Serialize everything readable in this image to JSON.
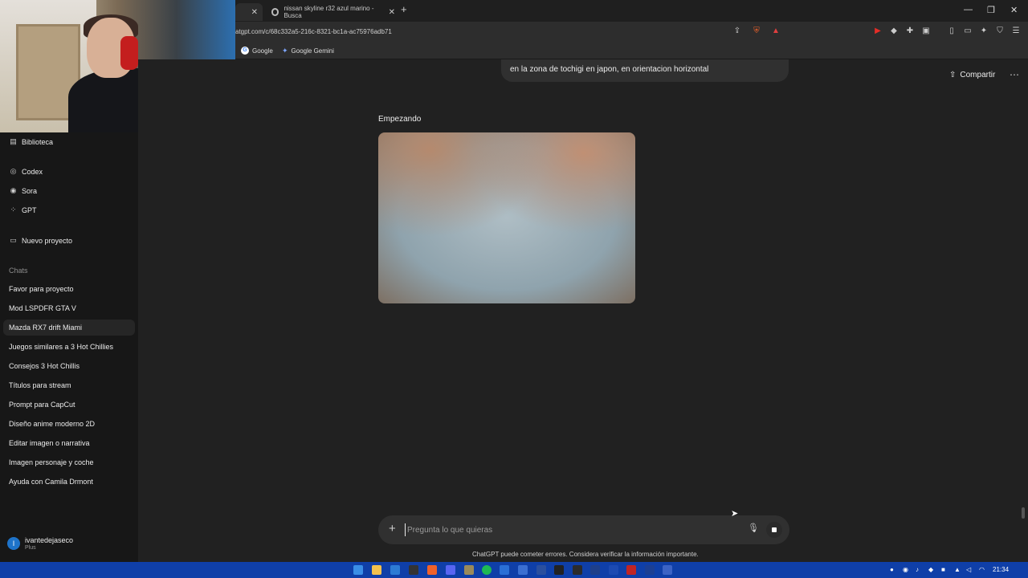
{
  "browser": {
    "tabs": [
      {
        "label": ""
      },
      {
        "label": "nissan skyline r32 azul marino - Busca"
      }
    ],
    "url": "atgpt.com/c/68c332a5-216c-8321-bc1a-ac75976adb71",
    "bookmarks": [
      {
        "label": "Google"
      },
      {
        "label": "Google Gemini"
      }
    ]
  },
  "sidebar": {
    "top_items": [
      {
        "label": "Biblioteca",
        "icon": "library-icon"
      },
      {
        "label": "Codex",
        "icon": "codex-icon"
      },
      {
        "label": "Sora",
        "icon": "sora-icon"
      },
      {
        "label": "GPT",
        "icon": "gpt-grid-icon"
      },
      {
        "label": "Nuevo proyecto",
        "icon": "folder-icon"
      }
    ],
    "chats_heading": "Chats",
    "chats": [
      {
        "label": "Favor para proyecto"
      },
      {
        "label": "Mod LSPDFR GTA V"
      },
      {
        "label": "Mazda RX7 drift Miami"
      },
      {
        "label": "Juegos similares a 3 Hot Chillies"
      },
      {
        "label": "Consejos 3 Hot Chillis"
      },
      {
        "label": "Títulos para stream"
      },
      {
        "label": "Prompt para CapCut"
      },
      {
        "label": "Diseño anime moderno 2D"
      },
      {
        "label": "Editar imagen o narrativa"
      },
      {
        "label": "Imagen personaje y coche"
      },
      {
        "label": "Ayuda con Camila Drmont"
      }
    ],
    "active_chat_index": 2,
    "user": {
      "initial": "I",
      "name": "ivantedejaseco",
      "plan": "Plus"
    }
  },
  "main": {
    "user_message_tail": "en la zona de tochigi en japon, en orientacion horizontal",
    "share_label": "Compartir",
    "status_label": "Empezando",
    "composer": {
      "placeholder": "Pregunta lo que quieras"
    },
    "disclaimer": "ChatGPT puede cometer errores. Considera verificar la información importante."
  },
  "taskbar": {
    "time": "21:34"
  },
  "colors": {
    "background": "#212121",
    "sidebar": "#171717",
    "composer": "#303030",
    "taskbar": "#0f3fa8"
  }
}
